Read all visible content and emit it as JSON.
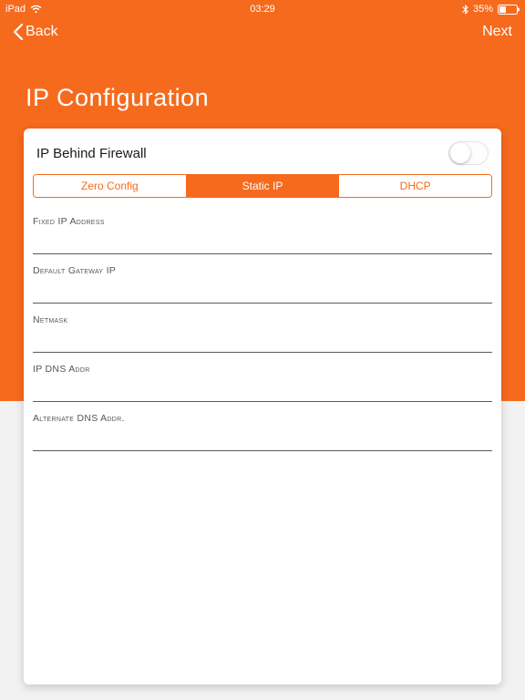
{
  "status": {
    "device": "iPad",
    "time": "03:29",
    "battery_pct": "35%"
  },
  "nav": {
    "back": "Back",
    "next": "Next"
  },
  "page": {
    "title": "IP Configuration"
  },
  "card": {
    "firewall_label": "IP Behind Firewall",
    "firewall_on": false,
    "segments": [
      {
        "label": "Zero Config",
        "active": false
      },
      {
        "label": "Static IP",
        "active": true
      },
      {
        "label": "DHCP",
        "active": false
      }
    ],
    "fields": [
      {
        "label": "Fixed IP Address",
        "value": ""
      },
      {
        "label": "Default Gateway IP",
        "value": ""
      },
      {
        "label": "Netmask",
        "value": ""
      },
      {
        "label": "IP DNS Addr",
        "value": ""
      },
      {
        "label": "Alternate DNS Addr.",
        "value": ""
      }
    ]
  },
  "colors": {
    "accent": "#f66a1d"
  }
}
